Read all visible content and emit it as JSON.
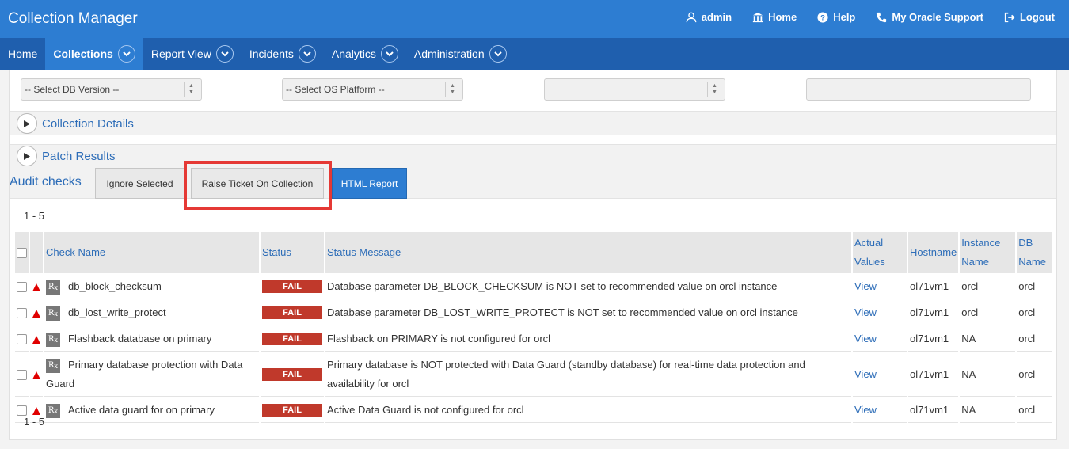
{
  "header": {
    "title": "Collection Manager",
    "links": [
      {
        "label": "admin",
        "icon": "user-icon"
      },
      {
        "label": "Home",
        "icon": "home-icon"
      },
      {
        "label": "Help",
        "icon": "help-icon"
      },
      {
        "label": "My Oracle Support",
        "icon": "phone-icon"
      },
      {
        "label": "Logout",
        "icon": "logout-icon"
      }
    ]
  },
  "nav": {
    "items": [
      {
        "label": "Home"
      },
      {
        "label": "Collections"
      },
      {
        "label": "Report View"
      },
      {
        "label": "Incidents"
      },
      {
        "label": "Analytics"
      },
      {
        "label": "Administration"
      }
    ]
  },
  "filters": {
    "db_version": "-- Select DB Version --",
    "os_platform": "-- Select OS Platform --",
    "third_select": "",
    "fourth_input": ""
  },
  "sections": {
    "collection_details": "Collection Details",
    "patch_results": "Patch Results"
  },
  "audit": {
    "title": "Audit checks",
    "ignore_selected": "Ignore Selected",
    "raise_ticket": "Raise Ticket On Collection",
    "html_report": "HTML Report"
  },
  "pager": {
    "top": "1 - 5",
    "bottom": "1 - 5"
  },
  "table": {
    "headers": {
      "check_name": "Check Name",
      "status": "Status",
      "status_message": "Status Message",
      "actual_values_1": "Actual",
      "actual_values_2": "Values",
      "hostname": "Hostname",
      "instance_name_1": "Instance",
      "instance_name_2": "Name",
      "db_name_1": "DB",
      "db_name_2": "Name"
    },
    "rows": [
      {
        "check": "db_block_checksum",
        "status": "FAIL",
        "message": "Database parameter DB_BLOCK_CHECKSUM is NOT set to recommended value on orcl instance",
        "view": "View",
        "host": "ol71vm1",
        "instance": "orcl",
        "db": "orcl"
      },
      {
        "check": "db_lost_write_protect",
        "status": "FAIL",
        "message": "Database parameter DB_LOST_WRITE_PROTECT is NOT set to recommended value on orcl instance",
        "view": "View",
        "host": "ol71vm1",
        "instance": "orcl",
        "db": "orcl"
      },
      {
        "check": "Flashback database on primary",
        "status": "FAIL",
        "message": "Flashback on PRIMARY is not configured for orcl",
        "view": "View",
        "host": "ol71vm1",
        "instance": "NA",
        "db": "orcl"
      },
      {
        "check": "Primary database protection with Data Guard",
        "status": "FAIL",
        "message": "Primary database is NOT protected with Data Guard (standby database) for real-time data protection and availability for orcl",
        "view": "View",
        "host": "ol71vm1",
        "instance": "NA",
        "db": "orcl"
      },
      {
        "check": "Active data guard for on primary",
        "status": "FAIL",
        "message": "Active Data Guard is not configured for orcl",
        "view": "View",
        "host": "ol71vm1",
        "instance": "NA",
        "db": "orcl"
      }
    ]
  },
  "colors": {
    "header_bg": "#2d7dd2",
    "nav_bg": "#1f5fae",
    "fail_badge": "#c0392b",
    "link": "#2d6db8",
    "highlight": "#e53935"
  }
}
